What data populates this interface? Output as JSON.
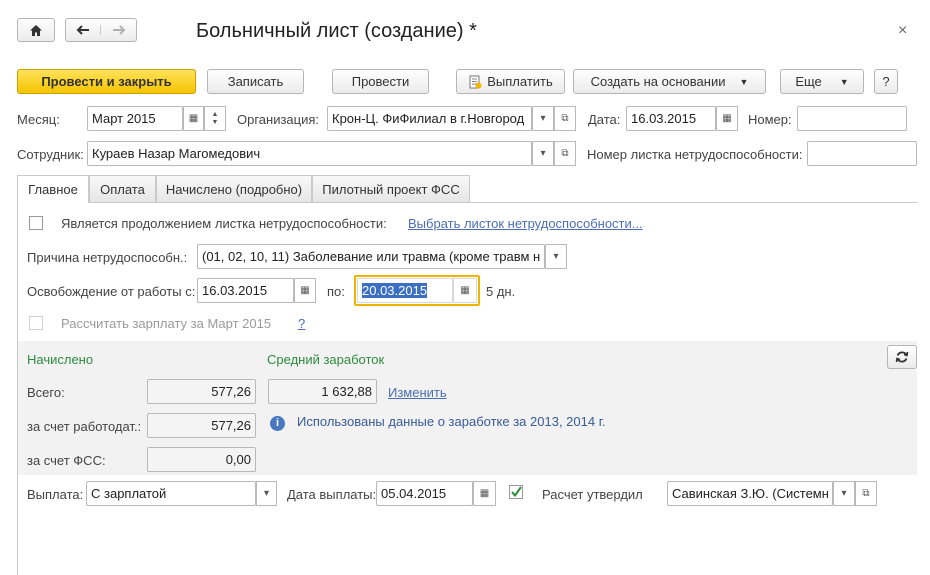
{
  "title": "Больничный лист (создание) *",
  "toolbar": {
    "post_close": "Провести и закрыть",
    "save": "Записать",
    "post": "Провести",
    "pay": "Выплатить",
    "create_based": "Создать на основании",
    "more": "Еще",
    "help": "?"
  },
  "header": {
    "month_label": "Месяц:",
    "month_value": "Март 2015",
    "org_label": "Организация:",
    "org_value": "Крон-Ц. ФиФилиал в г.Новгород",
    "date_label": "Дата:",
    "date_value": "16.03.2015",
    "number_label": "Номер:",
    "number_value": "",
    "employee_label": "Сотрудник:",
    "employee_value": "Кураев Назар Магомедович",
    "sheet_number_label": "Номер листка нетрудоспособности:",
    "sheet_number_value": ""
  },
  "tabs": [
    "Главное",
    "Оплата",
    "Начислено (подробно)",
    "Пилотный проект ФСС"
  ],
  "main": {
    "continuation_label": "Является продолжением листка нетрудоспособности:",
    "choose_sheet_link": "Выбрать листок нетрудоспособности...",
    "reason_label": "Причина нетрудоспособн.:",
    "reason_value": "(01, 02, 10, 11) Заболевание или травма (кроме травм на",
    "release_from_label": "Освобождение от работы с:",
    "release_from_value": "16.03.2015",
    "release_to_label": "по:",
    "release_to_value": "20.03.2015",
    "days_text": "5 дн.",
    "calc_salary_label": "Рассчитать зарплату за Март 2015",
    "calc_help": "?"
  },
  "accrued": {
    "heading": "Начислено",
    "total_label": "Всего:",
    "total_value": "577,26",
    "employer_label": "за счет работодат.:",
    "employer_value": "577,26",
    "fss_label": "за счет ФСС:",
    "fss_value": "0,00"
  },
  "average": {
    "heading": "Средний заработок",
    "value": "1 632,88",
    "change_link": "Изменить",
    "info_text": "Использованы данные о заработке за  2013,  2014 г."
  },
  "footer": {
    "payment_label": "Выплата:",
    "payment_value": "С зарплатой",
    "pay_date_label": "Дата выплаты:",
    "pay_date_value": "05.04.2015",
    "approved_label": "Расчет утвердил",
    "approved_value": "Савинская З.Ю. (Системны"
  },
  "colors": {
    "primary_button": "#f5c400",
    "accent_green": "#2e8b3e",
    "link": "#4a6fb3",
    "focus_border": "#f0b400",
    "selection": "#3b6fc4"
  }
}
